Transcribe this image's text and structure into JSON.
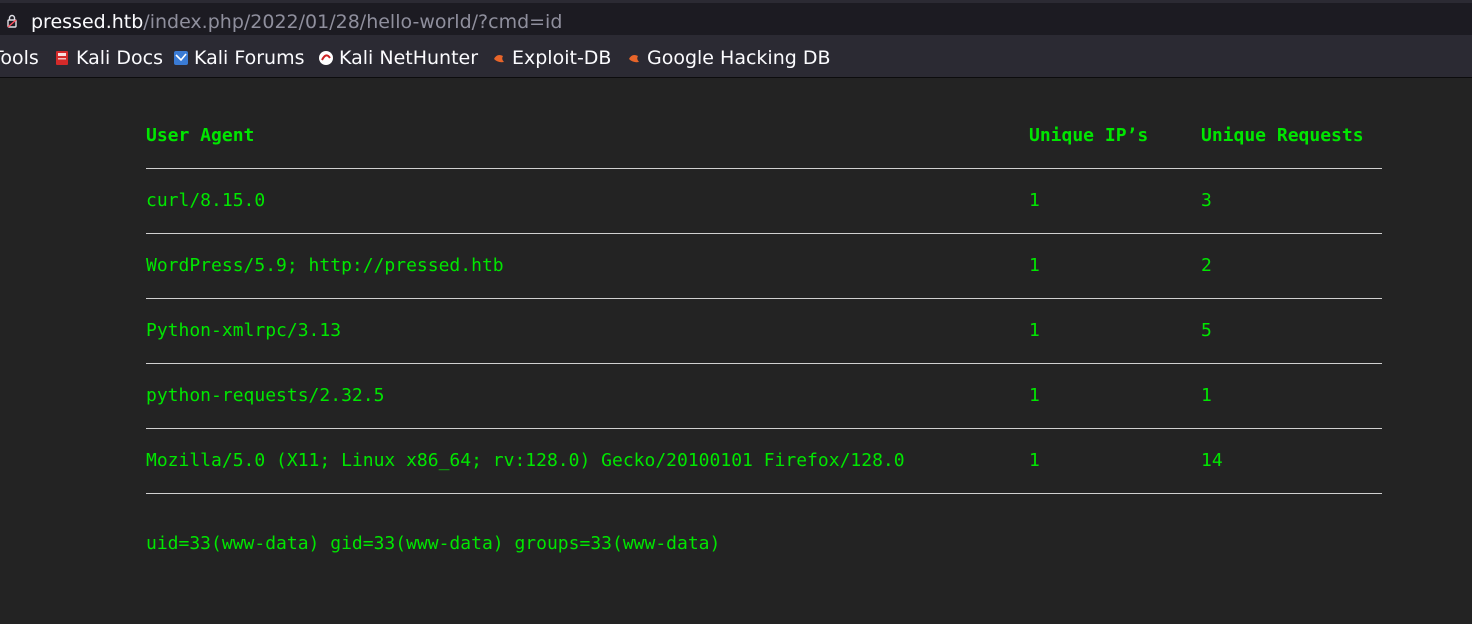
{
  "browser": {
    "url_host": "pressed.htb",
    "url_path": "/index.php/2022/01/28/hello-world/?cmd=id",
    "bookmarks": [
      {
        "label": "Tools",
        "icon": "none"
      },
      {
        "label": "Kali Docs",
        "icon": "kali-docs-icon"
      },
      {
        "label": "Kali Forums",
        "icon": "kali-forums-icon"
      },
      {
        "label": "Kali NetHunter",
        "icon": "kali-nethunter-icon"
      },
      {
        "label": "Exploit-DB",
        "icon": "exploit-db-icon"
      },
      {
        "label": "Google Hacking DB",
        "icon": "ghdb-icon"
      }
    ]
  },
  "table": {
    "headers": [
      "User Agent",
      "Unique IP’s",
      "Unique Requests"
    ],
    "rows": [
      {
        "agent": "curl/8.15.0",
        "ips": "1",
        "requests": "3"
      },
      {
        "agent": "WordPress/5.9; http://pressed.htb",
        "ips": "1",
        "requests": "2"
      },
      {
        "agent": "Python-xmlrpc/3.13",
        "ips": "1",
        "requests": "5"
      },
      {
        "agent": "python-requests/2.32.5",
        "ips": "1",
        "requests": "1"
      },
      {
        "agent": "Mozilla/5.0 (X11; Linux x86_64; rv:128.0) Gecko/20100101 Firefox/128.0",
        "ips": "1",
        "requests": "14"
      }
    ]
  },
  "command_output": "uid=33(www-data) gid=33(www-data) groups=33(www-data)",
  "colors": {
    "text_green": "#00e600",
    "background": "#232323"
  }
}
